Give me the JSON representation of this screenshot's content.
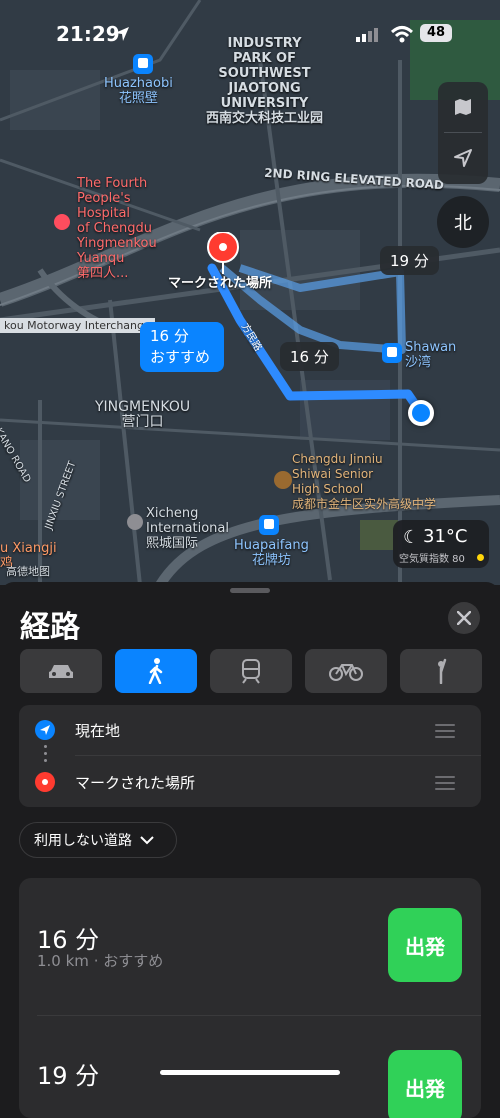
{
  "status_bar": {
    "time": "21:29",
    "battery": "48"
  },
  "map": {
    "labels": {
      "technology_park": "INDUSTRY\nPARK OF\nSOUTHWEST\nJIAOTONG\nUNIVERSITY\n西南交大科技工业园",
      "huazhaobi": "Huazhaobi\n花照壁",
      "hospital": "The Fourth\nPeople's\nHospital\nof Chengdu\nYingmenkou\nYuanqu\n第四人...",
      "ring_road": "2ND RING ELEVATED ROAD",
      "motorway": "kou Motorway Interchange",
      "yingmenkou": "YINGMENKOU\n营门口",
      "shawan": "Shawan\n沙湾",
      "jinniu_school": "Chengdu Jinniu\nShiwai Senior\nHigh School\n成都市金牛区实外高级中学",
      "xicheng": "Xicheng\nInternational\n熙城国际",
      "huapaifang": "Huapaifang\n花牌坊",
      "xiangji": "u Xiangji\n鸡",
      "jinxiu": "JINXIU STREET",
      "kanong": "KANO ROAD",
      "fangmin_road": "方民路",
      "attribution": "高德地图"
    },
    "pin_label": "マークされた場所",
    "route_tags": {
      "recommended_time": "16 分",
      "recommended_label": "おすすめ",
      "alt1": "19 分",
      "alt2": "16 分"
    },
    "compass": "北",
    "weather": {
      "temp": "31°C",
      "aqi": "空気質指数 80"
    }
  },
  "sheet": {
    "title": "経路",
    "modes": [
      "drive",
      "walk",
      "transit",
      "cycle",
      "rideshare"
    ],
    "active_mode": "walk",
    "stops": [
      {
        "label": "現在地"
      },
      {
        "label": "マークされた場所"
      }
    ],
    "avoid_label": "利用しない道路",
    "routes": [
      {
        "duration": "16 分",
        "details": "1.0 km · おすすめ",
        "go": "出発"
      },
      {
        "duration": "19 分",
        "details": "",
        "go": "出発"
      }
    ]
  },
  "colors": {
    "accent": "#0a84ff",
    "go": "#30d158",
    "pin": "#ff3b30"
  }
}
